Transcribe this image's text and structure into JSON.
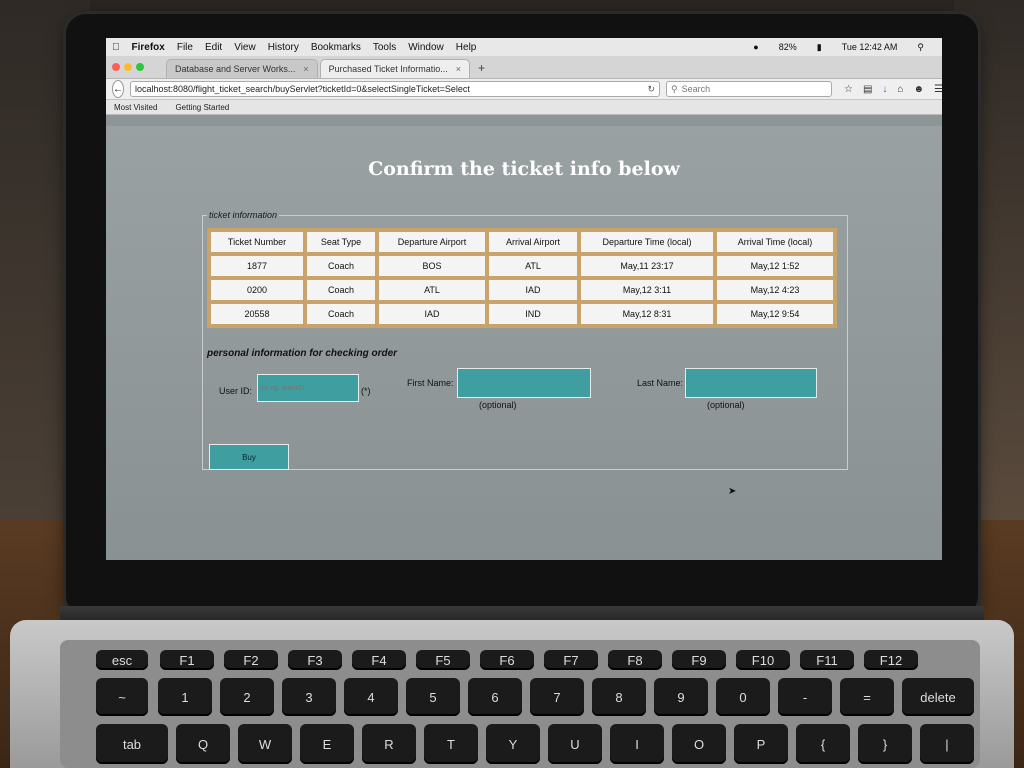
{
  "menubar": {
    "apple": "",
    "app": "Firefox",
    "items": [
      "File",
      "Edit",
      "View",
      "History",
      "Bookmarks",
      "Tools",
      "Window",
      "Help"
    ],
    "battery": "82%",
    "clock": "Tue 12:42 AM"
  },
  "tabs": [
    {
      "label": "Database and Server Works...",
      "close": "×"
    },
    {
      "label": "Purchased Ticket Informatio...",
      "close": "×"
    }
  ],
  "newtab": "+",
  "navbar": {
    "url": "localhost:8080/flight_ticket_search/buyServlet?ticketId=0&selectSingleTicket=Select",
    "search_placeholder": "Search"
  },
  "bookmarks": [
    "Most Visited",
    "Getting Started"
  ],
  "page": {
    "title": "Confirm the ticket info below",
    "legend": "ticket information",
    "columns": [
      "Ticket Number",
      "Seat Type",
      "Departure Airport",
      "Arrival Airport",
      "Departure Time (local)",
      "Arrival Time (local)"
    ],
    "rows": [
      [
        "1877",
        "Coach",
        "BOS",
        "ATL",
        "May,11 23:17",
        "May,12 1:52"
      ],
      [
        "0200",
        "Coach",
        "ATL",
        "IAD",
        "May,12 3:11",
        "May,12 4:23"
      ],
      [
        "20558",
        "Coach",
        "IAD",
        "IND",
        "May,12 8:31",
        "May,12 9:54"
      ]
    ],
    "section": "personal information for checking order",
    "user_id_label": "User ID:",
    "user_id_placeholder": "for eg. team07",
    "required_mark": "(*)",
    "first_name_label": "First Name:",
    "last_name_label": "Last Name:",
    "optional_note": "(optional)",
    "buy_label": "Buy"
  },
  "keyboard": {
    "fn_row": [
      "esc",
      "F1",
      "F2",
      "F3",
      "F4",
      "F5",
      "F6",
      "F7",
      "F8",
      "F9",
      "F10",
      "F11",
      "F12"
    ],
    "num_row": [
      "~",
      "1",
      "2",
      "3",
      "4",
      "5",
      "6",
      "7",
      "8",
      "9",
      "0",
      "-",
      "=",
      "delete"
    ],
    "q_row": [
      "tab",
      "Q",
      "W",
      "E",
      "R",
      "T",
      "Y",
      "U",
      "I",
      "O",
      "P",
      "{",
      "}",
      "|"
    ]
  },
  "colors": {
    "accent": "#3e9ea0",
    "table_border": "#c9a46a"
  }
}
